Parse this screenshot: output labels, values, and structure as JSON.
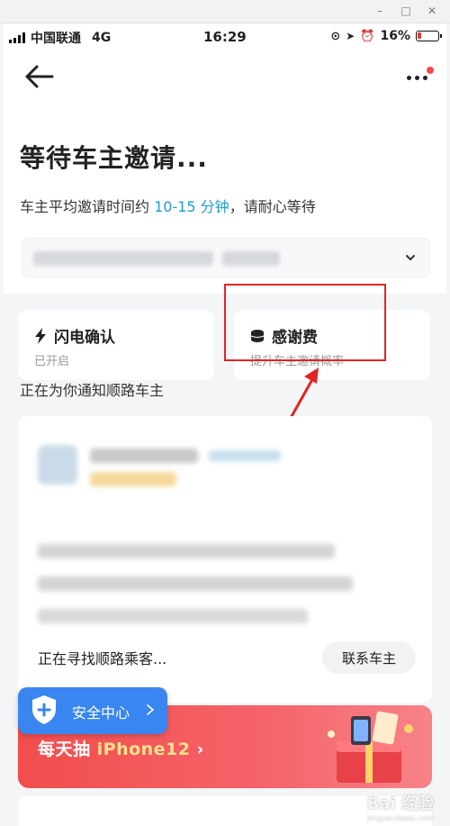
{
  "status_bar": {
    "carrier": "中国联通",
    "network": "4G",
    "time": "16:29",
    "battery": "16%"
  },
  "header": {
    "title": "等待车主邀请...",
    "subtitle_prefix": "车主平均邀请时间约 ",
    "subtitle_highlight": "10-15 分钟",
    "subtitle_suffix": "，请耐心等待"
  },
  "options": [
    {
      "title": "闪电确认",
      "subtitle": "已开启",
      "icon": "lightning-icon"
    },
    {
      "title": "感谢费",
      "subtitle": "提升车主邀请概率",
      "icon": "coin-stack-icon"
    }
  ],
  "notify_text": "正在为你通知顺路车主",
  "driver_card": {
    "finding_text": "正在寻找顺路乘客...",
    "contact_button": "联系车主"
  },
  "safety": {
    "label": "安全中心"
  },
  "promo": {
    "prefix": "每天抽 ",
    "product": "iPhone12"
  },
  "watermark": {
    "main": "Bai 经验",
    "sub": "jingyan.baidu.com"
  },
  "colors": {
    "accent": "#1f9bd1",
    "highlight_box": "#e22424",
    "promo_red": "#f24d4d",
    "safety_blue": "#3a86f0"
  }
}
